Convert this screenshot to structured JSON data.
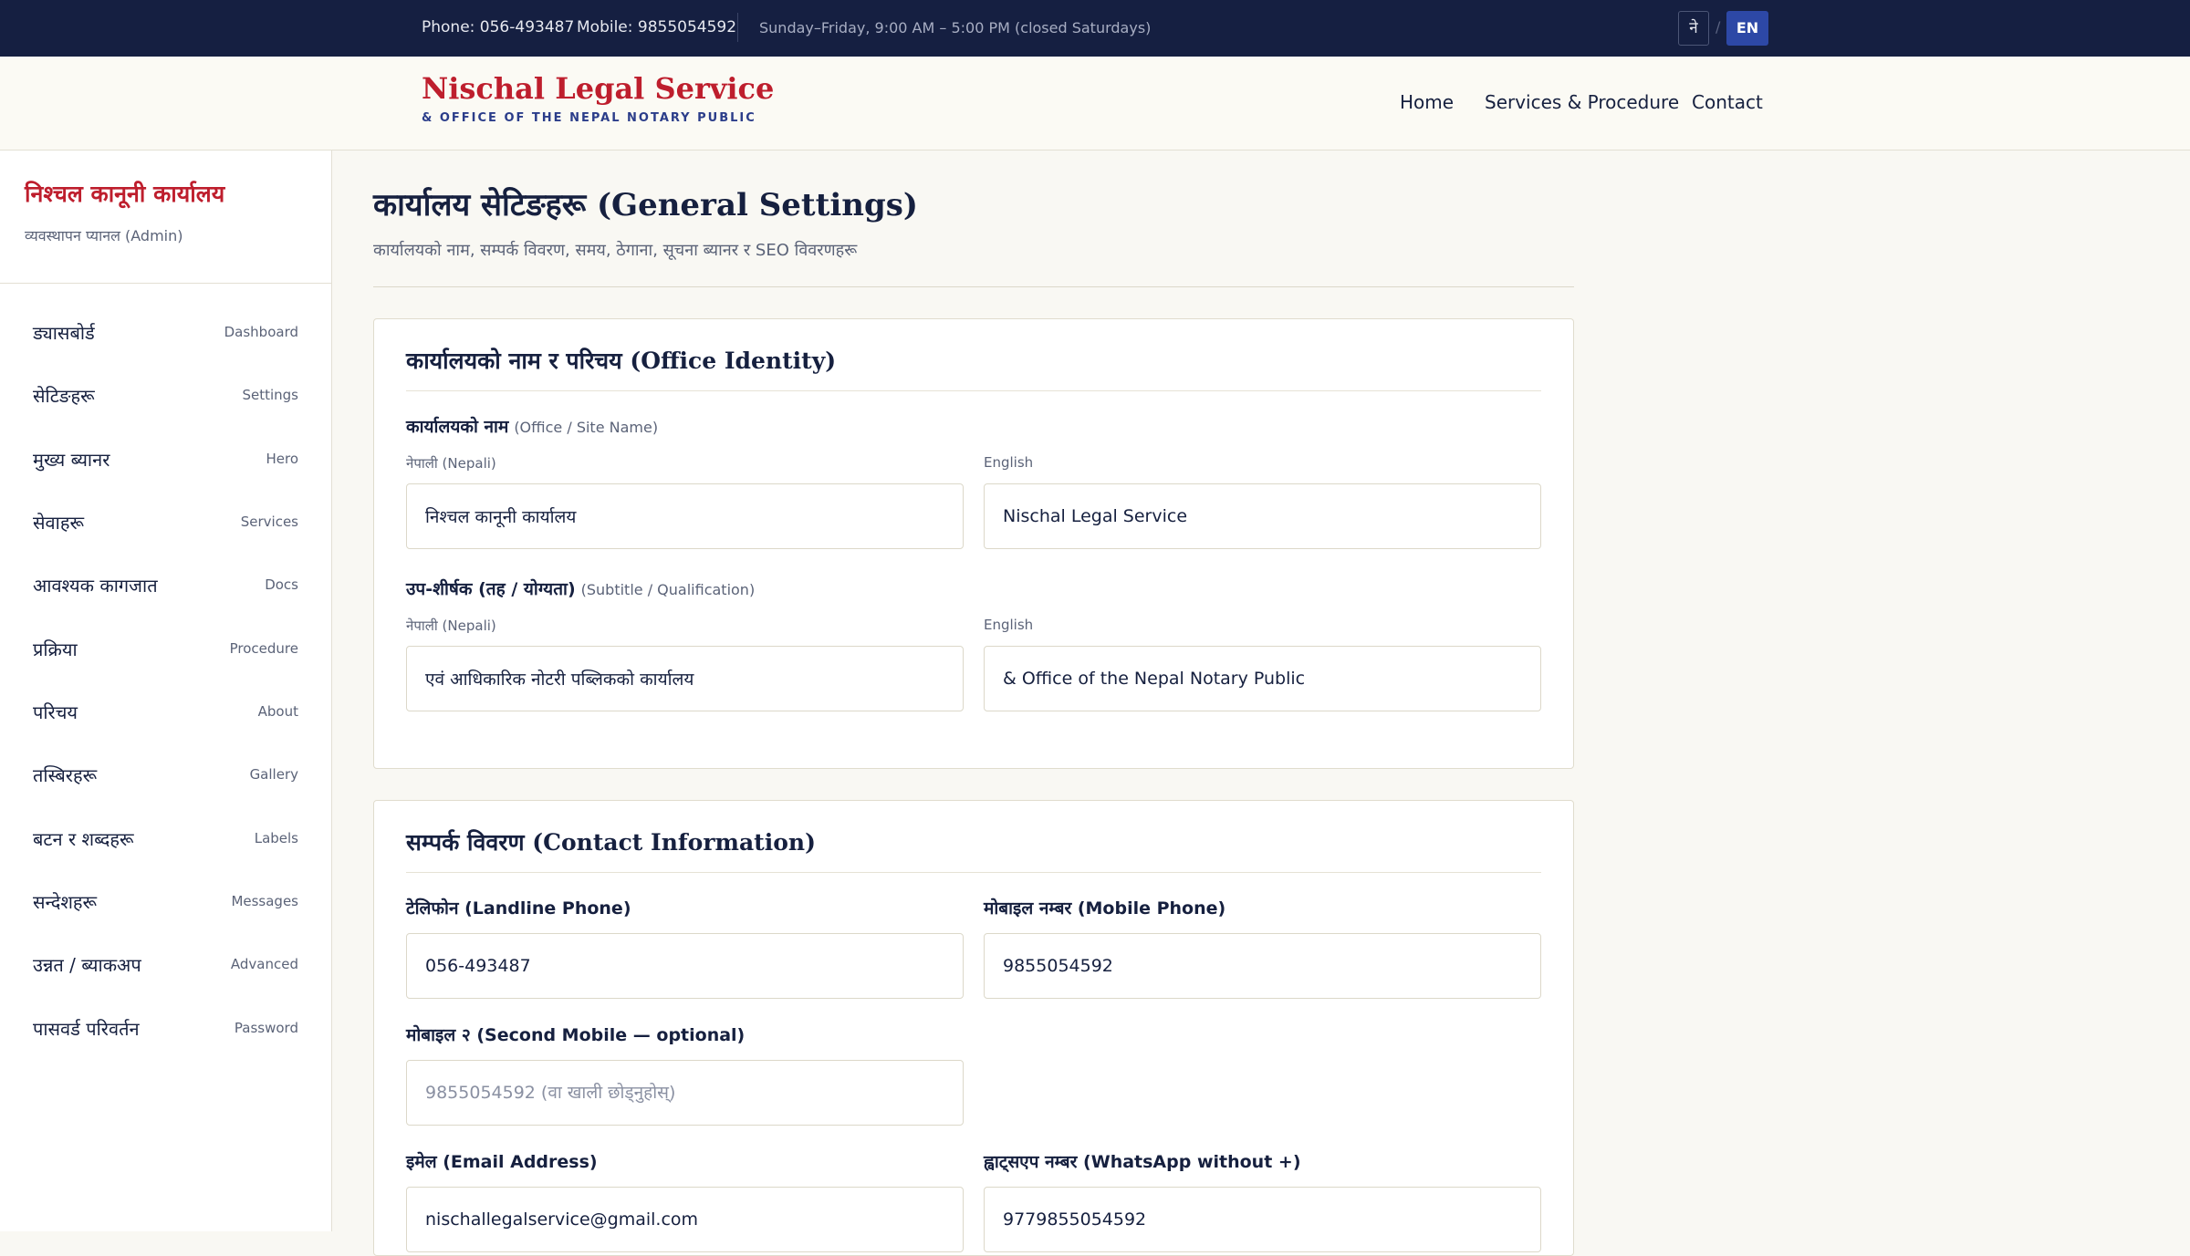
{
  "topbar": {
    "phone": "Phone: 056-493487",
    "mobile": "Mobile: 9855054592",
    "hours": "Sunday–Friday, 9:00 AM – 5:00 PM (closed Saturdays)",
    "lang_ne": "ने",
    "lang_sep": "/",
    "lang_en": "EN"
  },
  "header": {
    "brand_title": "Nischal Legal Service",
    "brand_subtitle": "& OFFICE OF THE NEPAL NOTARY PUBLIC",
    "nav": [
      "Home",
      "Services & Procedure",
      "Contact"
    ]
  },
  "sidebar": {
    "title": "निश्चल कानूनी कार्यालय",
    "subtitle": "व्यवस्थापन प्यानल (Admin)",
    "items": [
      {
        "ne": "ड्यासबोर्ड",
        "en": "Dashboard"
      },
      {
        "ne": "सेटिङहरू",
        "en": "Settings"
      },
      {
        "ne": "मुख्य ब्यानर",
        "en": "Hero"
      },
      {
        "ne": "सेवाहरू",
        "en": "Services"
      },
      {
        "ne": "आवश्यक कागजात",
        "en": "Docs"
      },
      {
        "ne": "प्रक्रिया",
        "en": "Procedure"
      },
      {
        "ne": "परिचय",
        "en": "About"
      },
      {
        "ne": "तस्बिरहरू",
        "en": "Gallery"
      },
      {
        "ne": "बटन र शब्दहरू",
        "en": "Labels"
      },
      {
        "ne": "सन्देशहरू",
        "en": "Messages"
      },
      {
        "ne": "उन्नत / ब्याकअप",
        "en": "Advanced"
      },
      {
        "ne": "पासवर्ड परिवर्तन",
        "en": "Password"
      }
    ]
  },
  "main": {
    "title": "कार्यालय सेटिङहरू (General Settings)",
    "subtitle": "कार्यालयको नाम, सम्पर्क विवरण, समय, ठेगाना, सूचना ब्यानर र SEO विवरणहरू",
    "identity": {
      "title": "कार्यालयको नाम र परिचय (Office Identity)",
      "site_name_label": "कार्यालयको नाम",
      "site_name_hint": "(Office / Site Name)",
      "nepali_label": "नेपाली (Nepali)",
      "english_label": "English",
      "site_name_ne": "निश्चल कानूनी कार्यालय",
      "site_name_en": "Nischal Legal Service",
      "subtitle_label": "उप-शीर्षक (तह / योग्यता)",
      "subtitle_hint": "(Subtitle / Qualification)",
      "subtitle_ne": "एवं आधिकारिक नोटरी पब्लिकको कार्यालय",
      "subtitle_en": "& Office of the Nepal Notary Public"
    },
    "contact": {
      "title": "सम्पर्क विवरण (Contact Information)",
      "landline_label": "टेलिफोन (Landline Phone)",
      "landline_value": "056-493487",
      "mobile_label": "मोबाइल नम्बर (Mobile Phone)",
      "mobile_value": "9855054592",
      "mobile2_label": "मोबाइल २ (Second Mobile — optional)",
      "mobile2_placeholder": "9855054592 (वा खाली छोड्नुहोस्)",
      "email_label": "इमेल (Email Address)",
      "email_value": "nischallegalservice@gmail.com",
      "whatsapp_label": "ह्वाट्सएप नम्बर (WhatsApp without +)",
      "whatsapp_value": "9779855054592"
    }
  }
}
